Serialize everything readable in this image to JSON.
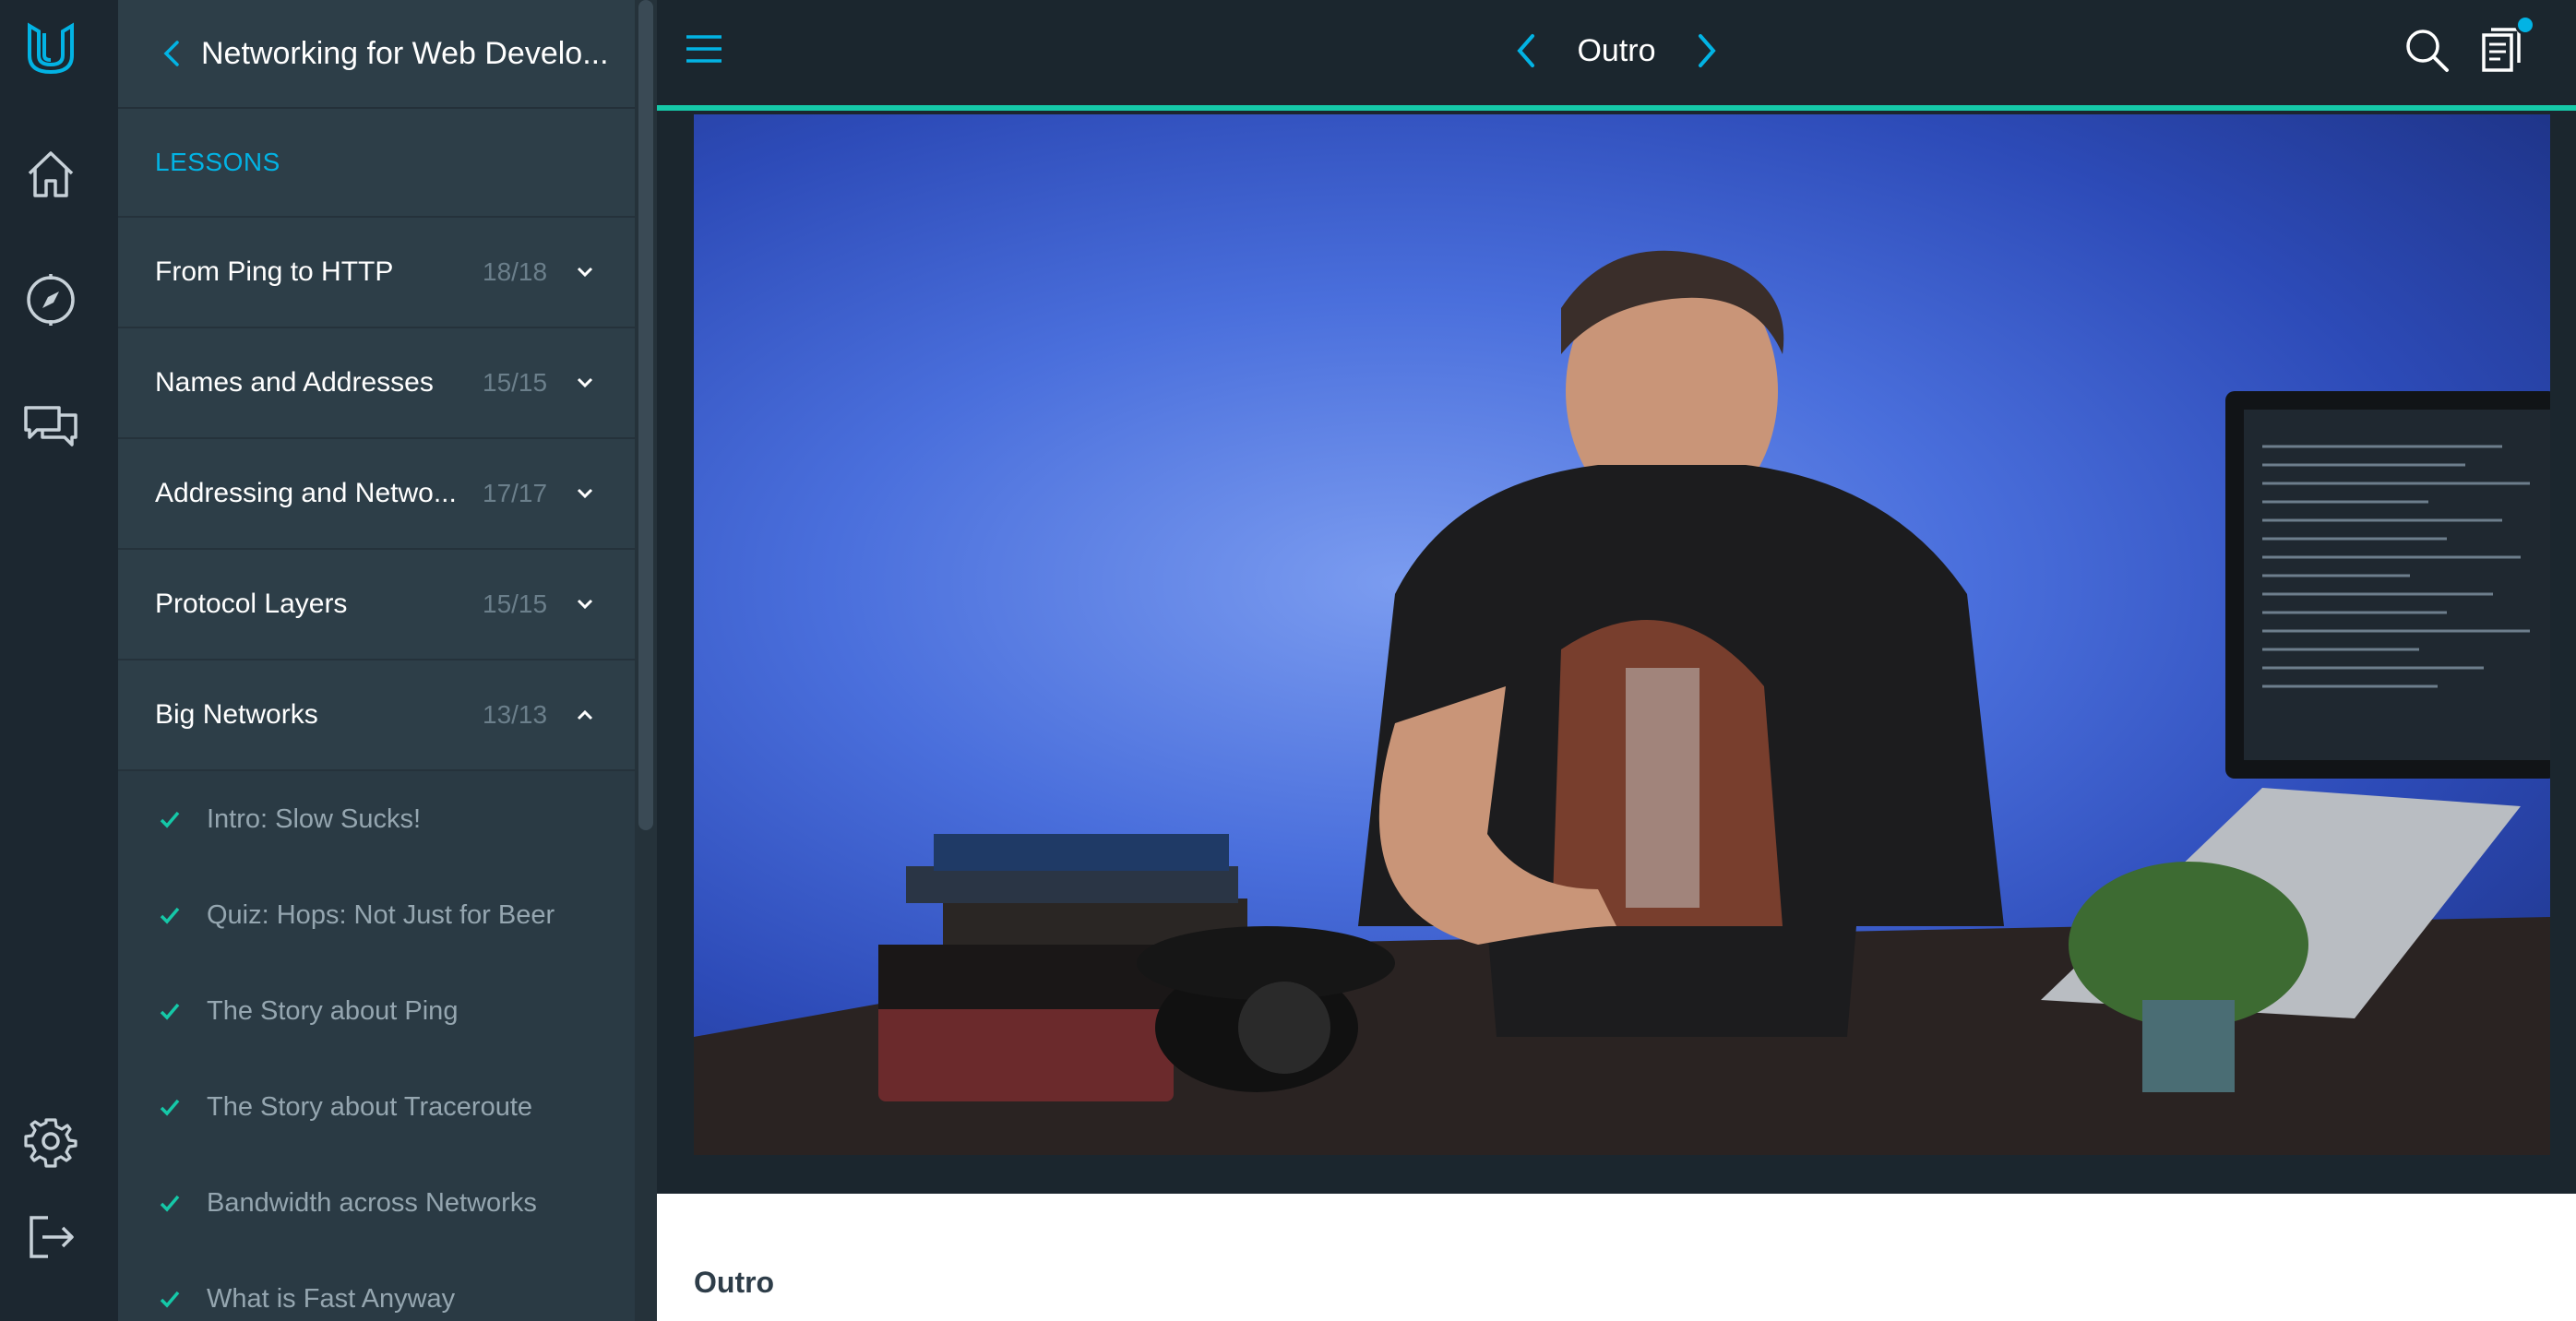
{
  "course": {
    "title": "Networking for Web Develo..."
  },
  "sidebar": {
    "section_label": "LESSONS",
    "lessons": [
      {
        "name": "From Ping to HTTP",
        "count": "18/18",
        "expanded": false
      },
      {
        "name": "Names and Addresses",
        "count": "15/15",
        "expanded": false
      },
      {
        "name": "Addressing and Netwo...",
        "count": "17/17",
        "expanded": false
      },
      {
        "name": "Protocol Layers",
        "count": "15/15",
        "expanded": false
      },
      {
        "name": "Big Networks",
        "count": "13/13",
        "expanded": true
      }
    ],
    "concepts": [
      {
        "name": "Intro: Slow Sucks!",
        "done": true
      },
      {
        "name": "Quiz: Hops: Not Just for Beer",
        "done": true
      },
      {
        "name": "The Story about Ping",
        "done": true
      },
      {
        "name": "The Story about Traceroute",
        "done": true
      },
      {
        "name": "Bandwidth across Networks",
        "done": true
      },
      {
        "name": "What is Fast Anyway",
        "done": true
      }
    ]
  },
  "rail": {
    "icons": [
      "udacity-logo-icon",
      "home-icon",
      "compass-icon",
      "chat-icon",
      "gear-icon",
      "logout-icon"
    ]
  },
  "topbar": {
    "title": "Outro",
    "icons": [
      "menu-icon",
      "prev-arrow-icon",
      "next-arrow-icon",
      "search-icon",
      "notes-icon"
    ]
  },
  "content": {
    "heading": "Outro"
  },
  "colors": {
    "accent": "#02b3e4",
    "progress": "#15c8a8",
    "rail_bg": "#1c2730",
    "sidebar_bg": "#2d3e48",
    "check": "#15c8a8"
  }
}
